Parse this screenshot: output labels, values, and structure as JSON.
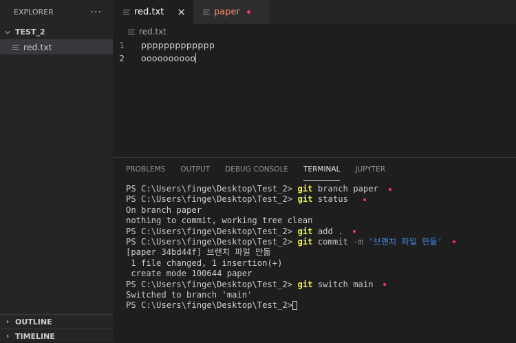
{
  "sidebar": {
    "title": "EXPLORER",
    "more": "···",
    "folder": "TEST_2",
    "file": "red.txt",
    "outline": "OUTLINE",
    "timeline": "TIMELINE"
  },
  "tabs": [
    {
      "label": "red.txt",
      "close": "✕"
    },
    {
      "label": "paper"
    }
  ],
  "breadcrumb": "red.txt",
  "editor": {
    "lines": [
      {
        "num": "1",
        "text": "ppppppppppppp"
      },
      {
        "num": "2",
        "text": "oooooooooo"
      }
    ]
  },
  "panel": {
    "tabs": [
      "PROBLEMS",
      "OUTPUT",
      "DEBUG CONSOLE",
      "TERMINAL",
      "JUPYTER"
    ],
    "active_tab": "TERMINAL"
  },
  "terminal": {
    "prompt": "PS C:\\Users\\finge\\Desktop\\Test_2>",
    "l1_cmd": "git",
    "l1_args": "branch paper",
    "l2_cmd": "git",
    "l2_args": "status",
    "l3": "On branch paper",
    "l4": "nothing to commit, working tree clean",
    "l5_cmd": "git",
    "l5_args": "add .",
    "l6_cmd": "git",
    "l6_args": "commit",
    "l6_opt": "-m",
    "l6_str": "'브랜치 파일 만듦'",
    "l7": "[paper 34bd44f] 브랜치 파일 만듦",
    "l8": " 1 file changed, 1 insertion(+)",
    "l9": " create mode 100644 paper",
    "l10_cmd": "git",
    "l10_args": "switch main",
    "l11": "Switched to branch 'main'"
  },
  "colors": {
    "annotation_dot": "#ff2e7e",
    "command": "#f5f543",
    "string": "#3b8eea",
    "modified_tab": "#f48771"
  }
}
